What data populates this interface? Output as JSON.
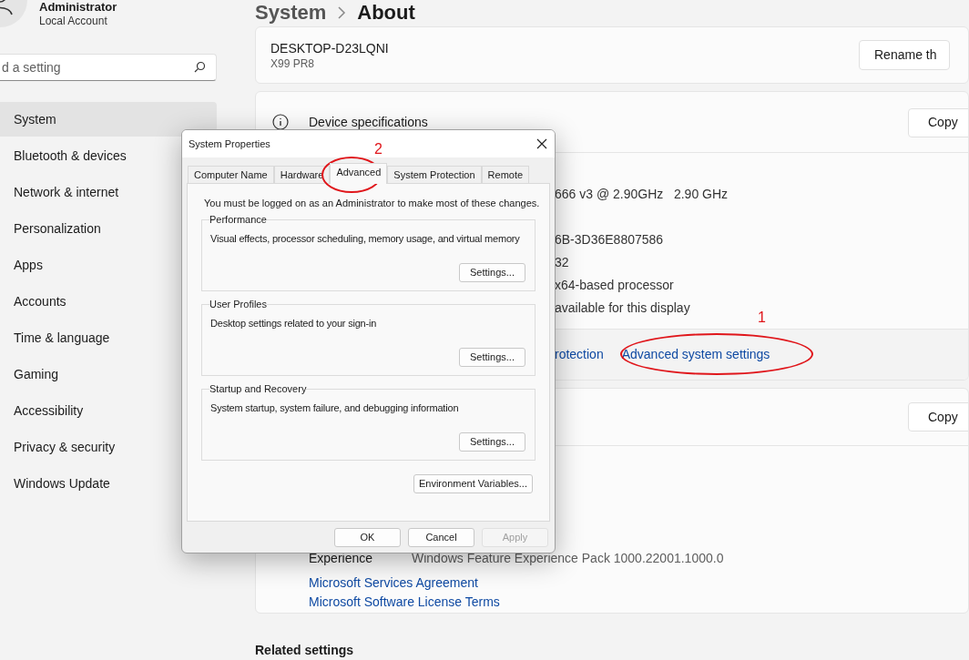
{
  "account": {
    "name": "Administrator",
    "type": "Local Account"
  },
  "search": {
    "placeholder": "d a setting"
  },
  "sidebar": {
    "items": [
      {
        "label": "System",
        "selected": true
      },
      {
        "label": "Bluetooth & devices",
        "selected": false
      },
      {
        "label": "Network & internet",
        "selected": false
      },
      {
        "label": "Personalization",
        "selected": false
      },
      {
        "label": "Apps",
        "selected": false
      },
      {
        "label": "Accounts",
        "selected": false
      },
      {
        "label": "Time & language",
        "selected": false
      },
      {
        "label": "Gaming",
        "selected": false
      },
      {
        "label": "Accessibility",
        "selected": false
      },
      {
        "label": "Privacy & security",
        "selected": false
      },
      {
        "label": "Windows Update",
        "selected": false
      }
    ]
  },
  "breadcrumb": {
    "parent": "System",
    "current": "About"
  },
  "device": {
    "name": "DESKTOP-D23LQNI",
    "model": "X99 PR8",
    "rename_button": "Rename th"
  },
  "device_specifications": {
    "title": "Device specifications",
    "copy_button": "Copy",
    "values": [
      "666 v3 @ 2.90GHz   2.90 GHz",
      "6B-3D36E8807586",
      "32",
      "x64-based processor",
      "available for this display"
    ],
    "links": [
      "rotection",
      "Advanced system settings"
    ]
  },
  "windows_specifications": {
    "copy_button": "Copy",
    "rows": [
      {
        "label": "Experience",
        "value": "Windows Feature Experience Pack 1000.22001.1000.0"
      }
    ],
    "links": [
      "Microsoft Services Agreement",
      "Microsoft Software License Terms"
    ]
  },
  "related_settings": {
    "title": "Related settings"
  },
  "dialog": {
    "title": "System Properties",
    "tabs": [
      {
        "label": "Computer Name",
        "selected": false
      },
      {
        "label": "Hardware",
        "selected": false
      },
      {
        "label": "Advanced",
        "selected": true
      },
      {
        "label": "System Protection",
        "selected": false
      },
      {
        "label": "Remote",
        "selected": false
      }
    ],
    "notice": "You must be logged on as an Administrator to make most of these changes.",
    "groups": [
      {
        "title": "Performance",
        "description": "Visual effects, processor scheduling, memory usage, and virtual memory",
        "button": "Settings..."
      },
      {
        "title": "User Profiles",
        "description": "Desktop settings related to your sign-in",
        "button": "Settings..."
      },
      {
        "title": "Startup and Recovery",
        "description": "System startup, system failure, and debugging information",
        "button": "Settings..."
      }
    ],
    "environment_button": "Environment Variables...",
    "buttons": [
      {
        "label": "OK",
        "disabled": false
      },
      {
        "label": "Cancel",
        "disabled": false
      },
      {
        "label": "Apply",
        "disabled": true
      }
    ]
  },
  "annotations": [
    {
      "text": "1"
    },
    {
      "text": "2"
    }
  ]
}
